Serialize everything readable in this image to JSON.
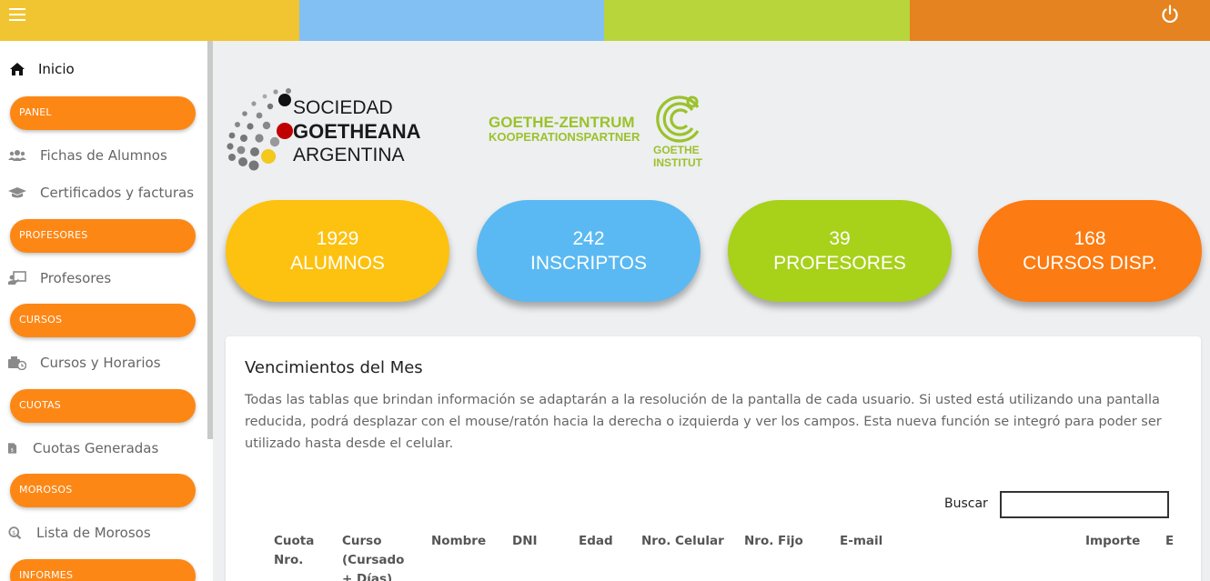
{
  "topbar": {
    "colors": [
      "#f0c531",
      "#82bff2",
      "#b9d53c",
      "#e4831f"
    ],
    "menu_icon": "hamburger-icon",
    "power_icon": "power-icon"
  },
  "sidebar": {
    "home": {
      "label": "Inicio",
      "icon": "home-icon"
    },
    "sections": [
      {
        "label": "PANEL"
      },
      {
        "label": "PROFESORES"
      },
      {
        "label": "CURSOS"
      },
      {
        "label": "CUOTAS"
      },
      {
        "label": "MOROSOS"
      },
      {
        "label": "INFORMES"
      }
    ],
    "items": [
      {
        "label": "Fichas de Alumnos",
        "icon": "users-icon"
      },
      {
        "label": "Certificados y facturas",
        "icon": "graduation-cap-icon"
      },
      {
        "label": "Profesores",
        "icon": "teacher-icon"
      },
      {
        "label": "Cursos y Horarios",
        "icon": "calendar-clock-icon"
      },
      {
        "label": "Cuotas Generadas",
        "icon": "invoice-icon"
      },
      {
        "label": "Lista de Morosos",
        "icon": "search-dollar-icon"
      }
    ]
  },
  "logos": {
    "sga": {
      "line1": "SOCIEDAD",
      "line2": "GOETHEANA",
      "line3": "ARGENTINA"
    },
    "goethe_zentrum": {
      "line1": "GOETHE-ZENTRUM",
      "line2": "KOOPERATIONSPARTNER"
    },
    "goethe_institut": {
      "line1": "GOETHE",
      "line2": "INSTITUT"
    }
  },
  "stats": [
    {
      "value": "1929",
      "label": "ALUMNOS",
      "color": "#fdc10f"
    },
    {
      "value": "242",
      "label": "INSCRIPTOS",
      "color": "#5ab9f2"
    },
    {
      "value": "39",
      "label": "PROFESORES",
      "color": "#a8d11a"
    },
    {
      "value": "168",
      "label": "CURSOS DISP.",
      "color": "#fc7b12"
    }
  ],
  "card": {
    "title": "Vencimientos del Mes",
    "description": "Todas las tablas que brindan información se adaptarán a la resolución de la pantalla de cada usuario. Si usted está utilizando una pantalla reducida, podrá desplazar con el mouse/ratón hacia la derecha o izquierda y ver los campos. Esta nueva función se integró para poder ser utilizado hasta desde el celular.",
    "search_label": "Buscar",
    "search_value": "",
    "columns": [
      "Cuota Nro.",
      "Curso (Cursado + Días)",
      "Nombre",
      "DNI",
      "Edad",
      "Nro. Celular",
      "Nro. Fijo",
      "E-mail",
      "Importe",
      "E"
    ]
  }
}
